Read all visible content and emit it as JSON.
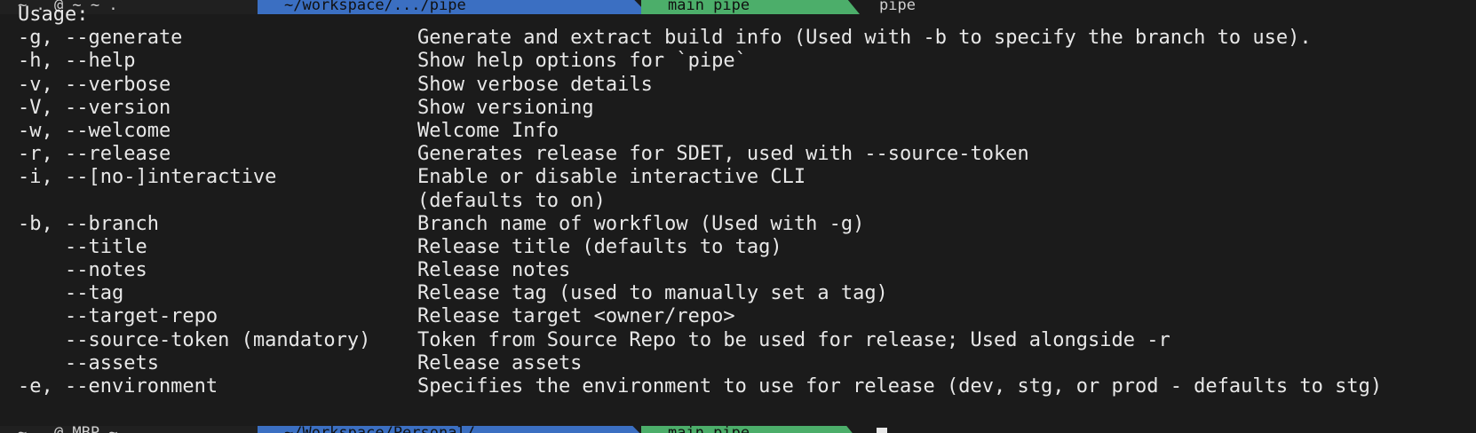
{
  "prompt_top": {
    "user": "~ . @ ~ ~ .",
    "path": "~/workspace/.../pipe",
    "branch": "main  pipe",
    "command": "pipe"
  },
  "prompt_bottom": {
    "user": "~ . @ MBP ~",
    "path": "~/Workspace/Personal/...",
    "branch": "main  pipe"
  },
  "help": {
    "usage_label": "Usage:",
    "rows": [
      {
        "option": "-g, --generate",
        "description": "Generate and extract build info (Used with -b to specify the branch to use)."
      },
      {
        "option": "-h, --help",
        "description": "Show help options for `pipe`"
      },
      {
        "option": "-v, --verbose",
        "description": "Show verbose details"
      },
      {
        "option": "-V, --version",
        "description": "Show versioning"
      },
      {
        "option": "-w, --welcome",
        "description": "Welcome Info"
      },
      {
        "option": "-r, --release",
        "description": "Generates release for SDET, used with --source-token"
      },
      {
        "option": "-i, --[no-]interactive",
        "description": "Enable or disable interactive CLI"
      },
      {
        "option": "",
        "description": "(defaults to on)"
      },
      {
        "option": "-b, --branch",
        "description": "Branch name of workflow (Used with -g)"
      },
      {
        "option": "    --title",
        "description": "Release title (defaults to tag)"
      },
      {
        "option": "    --notes",
        "description": "Release notes"
      },
      {
        "option": "    --tag",
        "description": "Release tag (used to manually set a tag)"
      },
      {
        "option": "    --target-repo",
        "description": "Release target <owner/repo>"
      },
      {
        "option": "    --source-token (mandatory)",
        "description": "Token from Source Repo to be used for release; Used alongside -r"
      },
      {
        "option": "    --assets",
        "description": "Release assets"
      },
      {
        "option": "-e, --environment",
        "description": "Specifies the environment to use for release (dev, stg, or prod - defaults to stg)"
      }
    ]
  }
}
